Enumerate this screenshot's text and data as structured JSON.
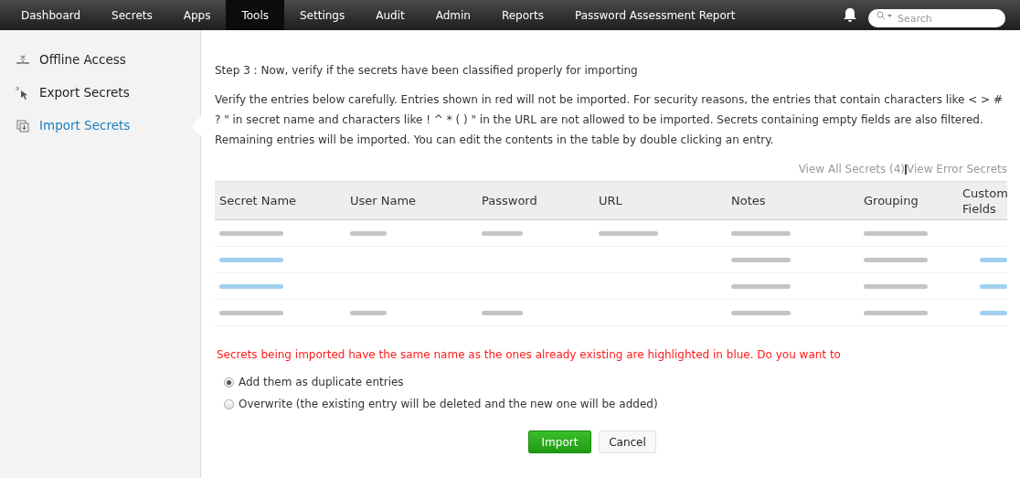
{
  "nav": {
    "tabs": [
      {
        "label": "Dashboard",
        "selected": false
      },
      {
        "label": "Secrets",
        "selected": false
      },
      {
        "label": "Apps",
        "selected": false
      },
      {
        "label": "Tools",
        "selected": true
      },
      {
        "label": "Settings",
        "selected": false
      },
      {
        "label": "Audit",
        "selected": false
      },
      {
        "label": "Admin",
        "selected": false
      },
      {
        "label": "Reports",
        "selected": false
      },
      {
        "label": "Password Assessment Report",
        "selected": false
      }
    ],
    "search": {
      "placeholder": "Search"
    }
  },
  "sidebar": {
    "items": [
      {
        "label": "Offline Access",
        "selected": false
      },
      {
        "label": "Export Secrets",
        "selected": false
      },
      {
        "label": "Import Secrets",
        "selected": true
      }
    ]
  },
  "step": "Step 3 : Now, verify if the secrets have been classified properly for importing",
  "instructions": "Verify the entries below carefully. Entries shown in red will not be imported. For security reasons, the entries that contain characters like < > # ? \" in secret name and characters like ! ^ * ( ) \" in the URL are not allowed to be imported. Secrets containing empty fields are also filtered. Remaining entries will be imported. You can edit the contents in the table by double clicking an entry.",
  "links": [
    "View All Secrets (4)",
    "View Error Secrets"
  ],
  "table": {
    "columns": [
      "Secret Name",
      "User Name",
      "Password",
      "URL",
      "Notes",
      "Grouping",
      "Custom Fields"
    ],
    "rows": [
      {
        "cells": [
          {
            "kind": "blurred",
            "color": "#c4c4c4"
          },
          {
            "kind": "blurred",
            "color": "#c4c4c4"
          },
          {
            "kind": "blurred",
            "color": "#c4c4c4"
          },
          {
            "kind": "blurred",
            "color": "#c4c4c4"
          },
          {
            "kind": "blurred",
            "color": "#c4c4c4"
          },
          {
            "kind": "blurred",
            "color": "#c4c4c4"
          },
          {
            "kind": "empty"
          }
        ]
      },
      {
        "cells": [
          {
            "kind": "blurred",
            "color": "#9fd0f0"
          },
          {
            "kind": "empty"
          },
          {
            "kind": "empty"
          },
          {
            "kind": "empty"
          },
          {
            "kind": "blurred",
            "color": "#c4c4c4"
          },
          {
            "kind": "blurred",
            "color": "#c4c4c4"
          },
          {
            "kind": "blurred",
            "color": "#9fd0f0"
          }
        ]
      },
      {
        "cells": [
          {
            "kind": "blurred",
            "color": "#9fd0f0"
          },
          {
            "kind": "empty"
          },
          {
            "kind": "empty"
          },
          {
            "kind": "empty"
          },
          {
            "kind": "blurred",
            "color": "#c4c4c4"
          },
          {
            "kind": "blurred",
            "color": "#c4c4c4"
          },
          {
            "kind": "blurred",
            "color": "#9fd0f0"
          }
        ]
      },
      {
        "cells": [
          {
            "kind": "blurred",
            "color": "#c4c4c4"
          },
          {
            "kind": "blurred",
            "color": "#c4c4c4"
          },
          {
            "kind": "blurred",
            "color": "#c4c4c4"
          },
          {
            "kind": "empty"
          },
          {
            "kind": "blurred",
            "color": "#c4c4c4"
          },
          {
            "kind": "blurred",
            "color": "#c4c4c4"
          },
          {
            "kind": "blurred",
            "color": "#9fd0f0"
          }
        ]
      }
    ]
  },
  "warning": "Secrets being imported have the same name as the ones already existing are highlighted in blue. Do you want to",
  "options": [
    {
      "label": "Add them as duplicate entries",
      "selected": true
    },
    {
      "label": "Overwrite (the existing entry will be deleted and the new one will be added)",
      "selected": false
    }
  ],
  "buttons": [
    {
      "label": "Import",
      "kind": "primary"
    },
    {
      "label": "Cancel",
      "kind": "secondary"
    }
  ]
}
